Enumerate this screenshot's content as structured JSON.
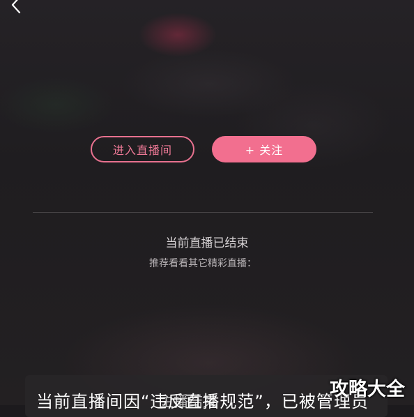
{
  "nav": {
    "back_icon": "chevron-left-icon"
  },
  "actions": {
    "enter_live_label": "进入直播间",
    "follow_label": "+ 关注"
  },
  "status": {
    "ended_text": "当前直播已结束",
    "recommend_text": "推荐看看其它精彩直播："
  },
  "notice": {
    "text": "当前直播间因“违反直播规范”，已被管理员",
    "overlay_text": "主播结束"
  },
  "watermark": {
    "text": "攻略大全"
  },
  "colors": {
    "accent": "#f26f8f",
    "background": "#1c1a1d"
  }
}
